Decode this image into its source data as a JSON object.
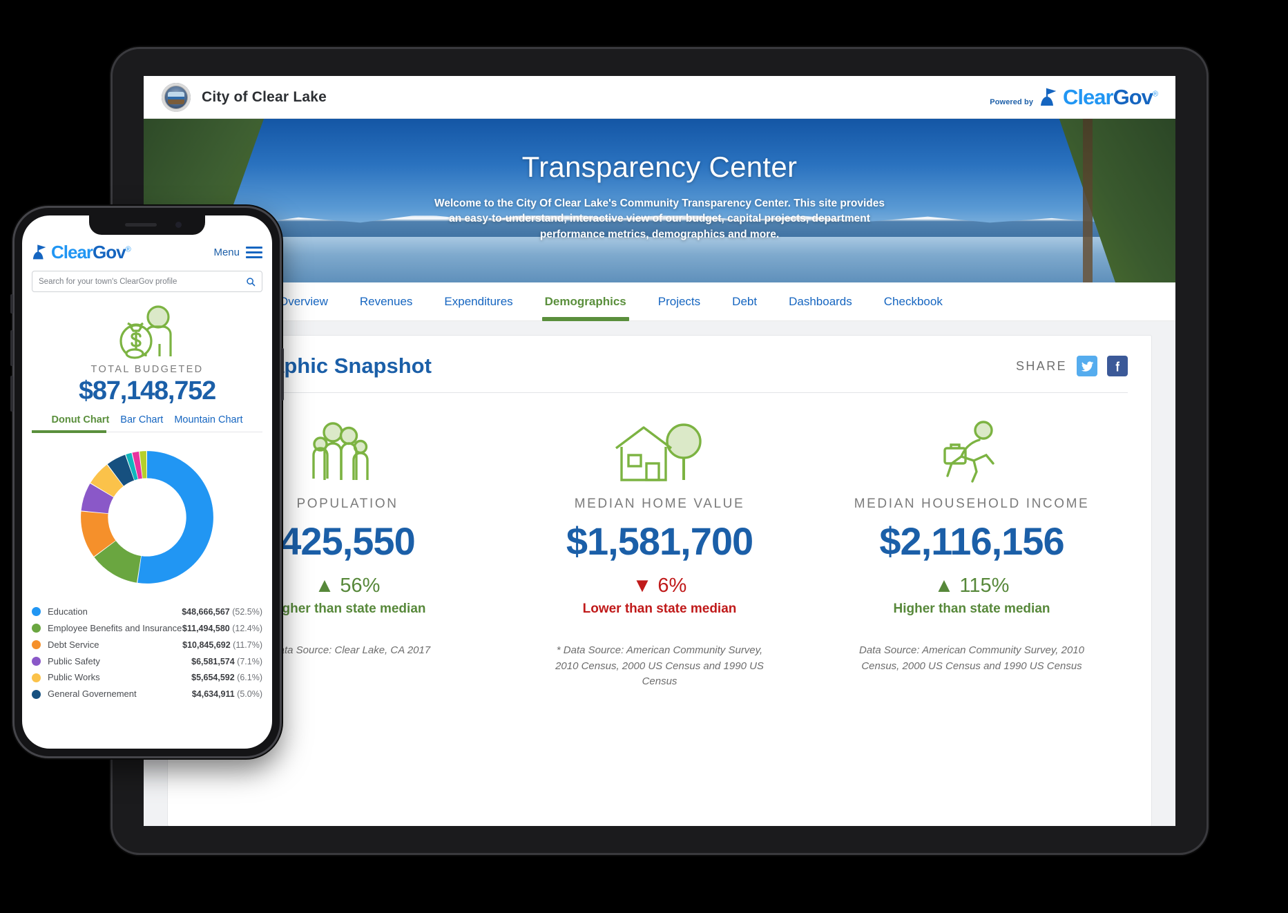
{
  "tablet": {
    "topbar": {
      "city_name": "City of Clear Lake",
      "seal_icon": "city-seal-icon",
      "powered_by": "Powered by",
      "logo_clear": "Clear",
      "logo_gov": "Gov",
      "logo_reg": "®"
    },
    "hero": {
      "title": "Transparency Center",
      "subtitle": "Welcome to the City Of Clear Lake's Community Transparency Center. This site provides an easy-to-understand, interactive view of our budget, capital projects, department performance metrics, demographics and more."
    },
    "nav": {
      "items": [
        {
          "label": "Overview",
          "active": false
        },
        {
          "label": "Revenues",
          "active": false
        },
        {
          "label": "Expenditures",
          "active": false
        },
        {
          "label": "Demographics",
          "active": true
        },
        {
          "label": "Projects",
          "active": false
        },
        {
          "label": "Debt",
          "active": false
        },
        {
          "label": "Dashboards",
          "active": false
        },
        {
          "label": "Checkbook",
          "active": false
        }
      ]
    },
    "card": {
      "title": "Demographic Snapshot",
      "share_label": "SHARE",
      "twitter_icon": "twitter-icon",
      "facebook_icon": "facebook-icon",
      "stats": [
        {
          "icon": "family-group-icon",
          "label": "POPULATION",
          "value": "425,550",
          "delta": "56%",
          "direction": "up",
          "arrow": "▲",
          "compare": "Higher than state median",
          "source": "* Data Source: Clear Lake, CA 2017"
        },
        {
          "icon": "house-tree-icon",
          "label": "MEDIAN HOME VALUE",
          "value": "$1,581,700",
          "delta": "6%",
          "direction": "down",
          "arrow": "▼",
          "compare": "Lower than state median",
          "source": "* Data Source: American Community Survey, 2010 Census, 2000 US Census and 1990 US Census"
        },
        {
          "icon": "working-person-icon",
          "label": "MEDIAN HOUSEHOLD INCOME",
          "value": "$2,116,156",
          "delta": "115%",
          "direction": "up",
          "arrow": "▲",
          "compare": "Higher than state median",
          "source": "Data Source: American Community Survey, 2010 Census, 2000 US Census and 1990 US Census"
        }
      ]
    }
  },
  "phone": {
    "header": {
      "logo_clear": "Clear",
      "logo_gov": "Gov",
      "logo_reg": "®",
      "menu_label": "Menu",
      "menu_icon": "hamburger-menu-icon"
    },
    "search": {
      "placeholder": "Search for your town's ClearGov profile",
      "search_icon": "search-icon"
    },
    "budget": {
      "icon": "money-bag-person-icon",
      "label": "TOTAL BUDGETED",
      "value": "$87,148,752"
    },
    "chart_tabs": [
      {
        "label": "Donut Chart",
        "active": true
      },
      {
        "label": "Bar Chart",
        "active": false
      },
      {
        "label": "Mountain Chart",
        "active": false
      }
    ]
  },
  "chart_data": {
    "type": "pie",
    "title": "TOTAL BUDGETED",
    "total": "$87,148,752",
    "variant": "donut",
    "legend_position": "below",
    "categories": [
      "Education",
      "Employee Benefits and Insurance",
      "Debt Service",
      "Public Safety",
      "Public Works",
      "General Governement"
    ],
    "values": [
      52.5,
      12.4,
      11.7,
      7.1,
      6.1,
      5.0
    ],
    "amounts": [
      "$48,666,567",
      "$11,494,580",
      "$10,845,692",
      "$6,581,574",
      "$5,654,592",
      "$4,634,911"
    ],
    "percent_labels": [
      "(52.5%)",
      "(12.4%)",
      "(11.7%)",
      "(7.1%)",
      "(6.1%)",
      "(5.0%)"
    ],
    "colors": [
      "#2196f3",
      "#6aa640",
      "#f5902b",
      "#8a58c8",
      "#fbc24a",
      "#16507f"
    ],
    "extra_slices": [
      {
        "color": "#10b6bd",
        "value": 1.6
      },
      {
        "color": "#e8339e",
        "value": 1.8
      },
      {
        "color": "#b6cf2b",
        "value": 1.8
      }
    ]
  }
}
